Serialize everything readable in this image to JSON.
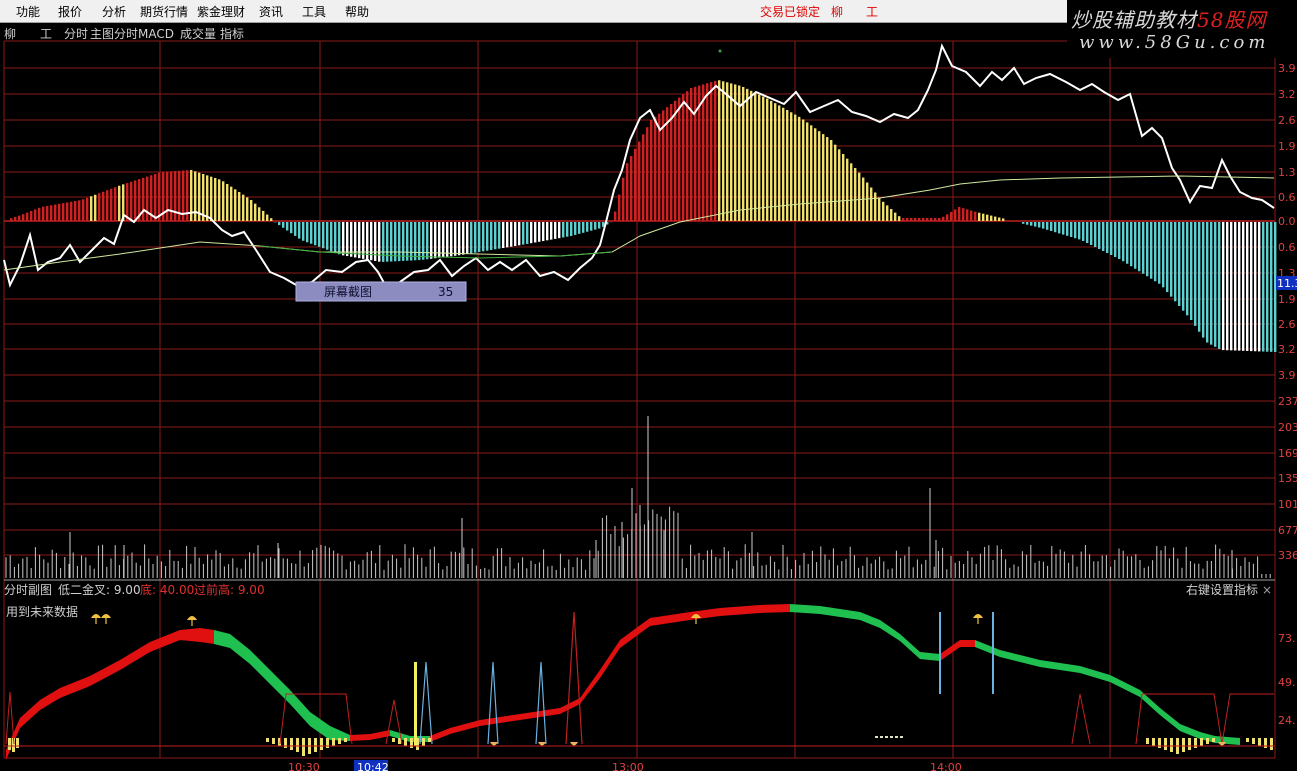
{
  "menu": {
    "items": [
      "功能",
      "报价",
      "分析",
      "期货行情",
      "紫金理财",
      "资讯",
      "工具",
      "帮助"
    ],
    "status": "交易已锁定",
    "user_a": "柳",
    "user_b": "工"
  },
  "watermark": {
    "title_a": "炒股辅助教材",
    "title_b": "58股网",
    "url": "www.58Gu.com"
  },
  "toolbar": {
    "user_a": "柳",
    "user_b": "工",
    "mode": "分时",
    "main_chart": "主图分时MACD",
    "volume": "成交量",
    "indicator": "指标"
  },
  "popup": {
    "label": "屏幕截图",
    "value": "35"
  },
  "sub_panel": {
    "title": "分时副图",
    "param1": "低二金叉: 9.00",
    "param2": "底: 40.00",
    "param3": "过前高: 9.00",
    "note": "用到未来数据",
    "right_label": "右键设置指标",
    "close": "×"
  },
  "axes": {
    "price_labels": [
      "3.9",
      "3.2",
      "2.6",
      "1.9",
      "1.3",
      "0.6",
      "0.0",
      "0.6",
      "1.3",
      "1.9",
      "2.6",
      "3.2",
      "3.9"
    ],
    "price_highlight": "11.3",
    "volume_labels": [
      "237",
      "203",
      "169",
      "135",
      "101",
      "677",
      "336"
    ],
    "sub_labels": [
      "73.",
      "49.",
      "24."
    ],
    "time_labels": [
      "10:30",
      "10:42",
      "13:00",
      "14:00"
    ]
  },
  "colors": {
    "background": "#000000",
    "grid": "#8b1a1a",
    "macd_up": "#cc2222",
    "macd_up_weak": "#f0e070",
    "macd_down": "#5fd0d0",
    "macd_down_weak": "#ffffff",
    "price_line": "#ffffff",
    "avg_line": "#d0e8a0",
    "ribbon_red": "#e01010",
    "ribbon_green": "#20c050",
    "signal_blue": "#6ab0e0"
  }
}
